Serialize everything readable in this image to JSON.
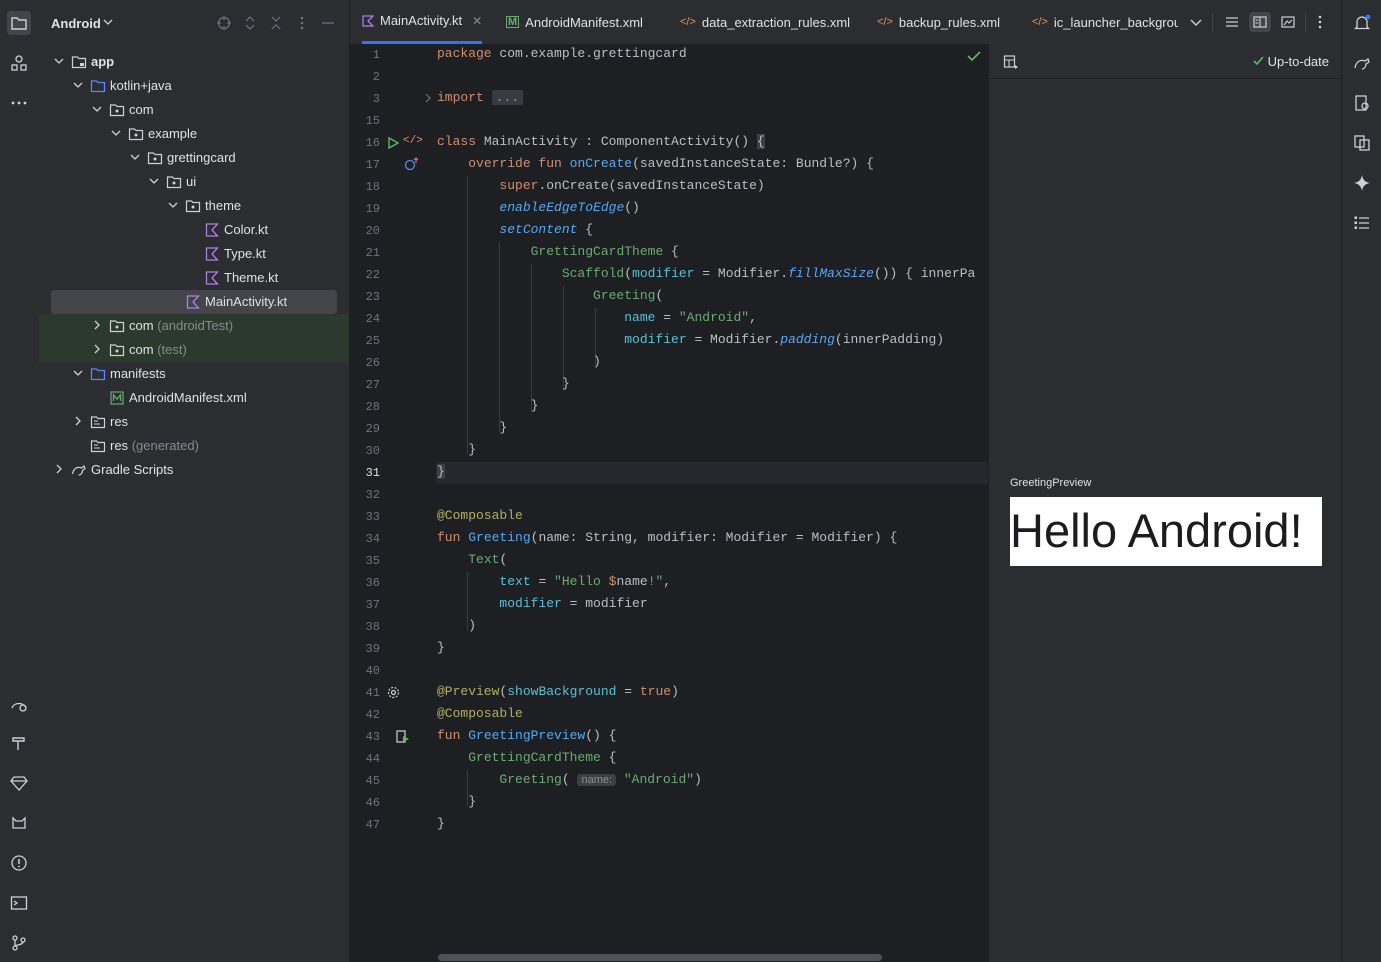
{
  "project": {
    "title": "Android",
    "tree": [
      {
        "label": "app",
        "muted": ""
      },
      {
        "label": "kotlin+java",
        "muted": ""
      },
      {
        "label": "com",
        "muted": ""
      },
      {
        "label": "example",
        "muted": ""
      },
      {
        "label": "grettingcard",
        "muted": ""
      },
      {
        "label": "ui",
        "muted": ""
      },
      {
        "label": "theme",
        "muted": ""
      },
      {
        "label": "Color.kt",
        "muted": ""
      },
      {
        "label": "Type.kt",
        "muted": ""
      },
      {
        "label": "Theme.kt",
        "muted": ""
      },
      {
        "label": "MainActivity.kt",
        "muted": ""
      },
      {
        "label": "com",
        "muted": "(androidTest)"
      },
      {
        "label": "com",
        "muted": "(test)"
      },
      {
        "label": "manifests",
        "muted": ""
      },
      {
        "label": "AndroidManifest.xml",
        "muted": ""
      },
      {
        "label": "res",
        "muted": ""
      },
      {
        "label": "res",
        "muted": "(generated)"
      },
      {
        "label": "Gradle Scripts",
        "muted": ""
      }
    ]
  },
  "tabs": [
    {
      "label": "MainActivity.kt"
    },
    {
      "label": "AndroidManifest.xml"
    },
    {
      "label": "data_extraction_rules.xml"
    },
    {
      "label": "backup_rules.xml"
    },
    {
      "label": "ic_launcher_backgroun"
    }
  ],
  "editor": {
    "line_numbers": [
      "1",
      "2",
      "3",
      "15",
      "16",
      "17",
      "18",
      "19",
      "20",
      "21",
      "22",
      "23",
      "24",
      "25",
      "26",
      "27",
      "28",
      "29",
      "30",
      "31",
      "32",
      "33",
      "34",
      "35",
      "36",
      "37",
      "38",
      "39",
      "40",
      "41",
      "42",
      "43",
      "44",
      "45",
      "46",
      "47"
    ],
    "current_line": "31",
    "import_fold": "...",
    "param_hint": "name:"
  },
  "preview": {
    "status": "Up-to-date",
    "label": "GreetingPreview",
    "rendered_text": "Hello Android!"
  },
  "colors": {
    "accent": "#3574f0",
    "keyword": "#cf8e6d",
    "function": "#56a8f5",
    "string": "#6aab73",
    "annotation": "#b3ae60"
  }
}
